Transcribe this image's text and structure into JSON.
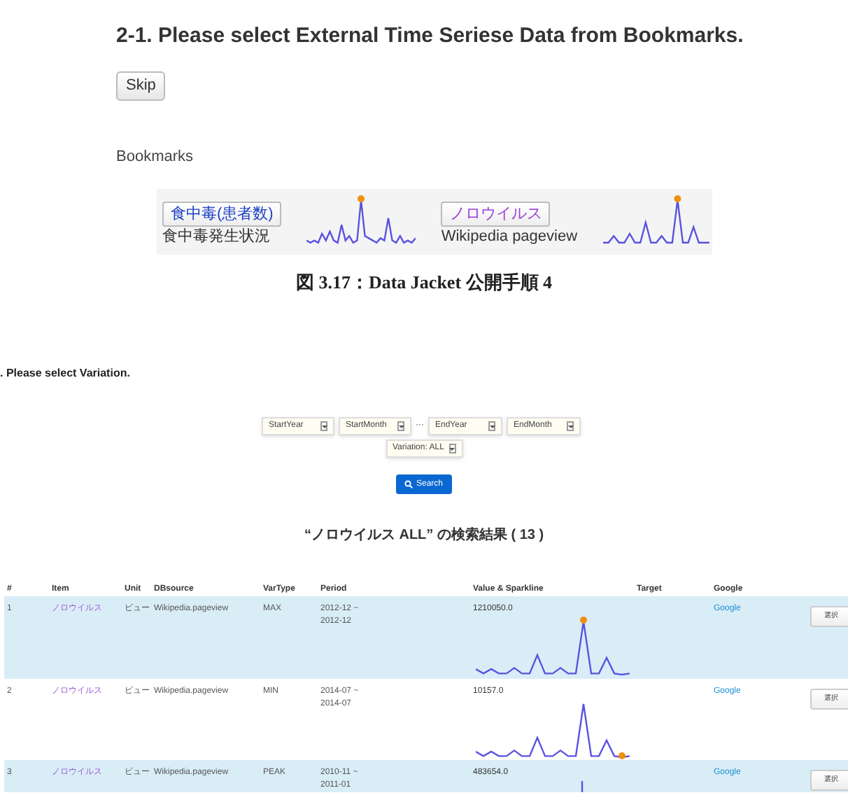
{
  "step1": {
    "heading": "2-1. Please select External Time Seriese Data from Bookmarks.",
    "skip_button": "Skip",
    "bookmarks_label": "Bookmarks",
    "bookmarks": [
      {
        "tag": "食中毒(患者数)",
        "source": "食中毒発生状況",
        "visited": false
      },
      {
        "tag": "ノロウイルス",
        "source": "Wikipedia pageview",
        "visited": true
      }
    ]
  },
  "caption": "図 3.17：Data Jacket 公開手順 4",
  "step2": {
    "heading": ". Please select Variation.",
    "selects": [
      {
        "value": "StartYear"
      },
      {
        "value": "StartMonth"
      },
      {
        "value": "EndYear"
      },
      {
        "value": "EndMonth"
      },
      {
        "value": "Variation: ALL"
      }
    ],
    "range_separator": "···",
    "search_button": "Search",
    "results_title": "“ノロウイルス ALL” の検索結果 ( 13 )"
  },
  "table": {
    "columns": [
      "#",
      "Item",
      "Unit",
      "DBsource",
      "VarType",
      "Period",
      "Value & Sparkline",
      "Target",
      "Google"
    ],
    "rows": [
      {
        "num": "1",
        "item": "ノロウイルス",
        "unit": "ビュー",
        "source": "Wikipedia.pageview",
        "vartype": "MAX",
        "period": "2012-12 ~ 2012-12",
        "value": "1210050.0",
        "google": "Google",
        "button": "選択",
        "selected": true
      },
      {
        "num": "2",
        "item": "ノロウイルス",
        "unit": "ビュー",
        "source": "Wikipedia.pageview",
        "vartype": "MIN",
        "period": "2014-07 ~ 2014-07",
        "value": "10157.0",
        "google": "Google",
        "button": "選択",
        "selected": false
      },
      {
        "num": "3",
        "item": "ノロウイルス",
        "unit": "ビュー",
        "source": "Wikipedia.pageview",
        "vartype": "PEAK",
        "period": "2010-11 ~ 2011-01",
        "value": "483654.0",
        "google": "Google",
        "button": "選択",
        "selected": true
      }
    ]
  }
}
